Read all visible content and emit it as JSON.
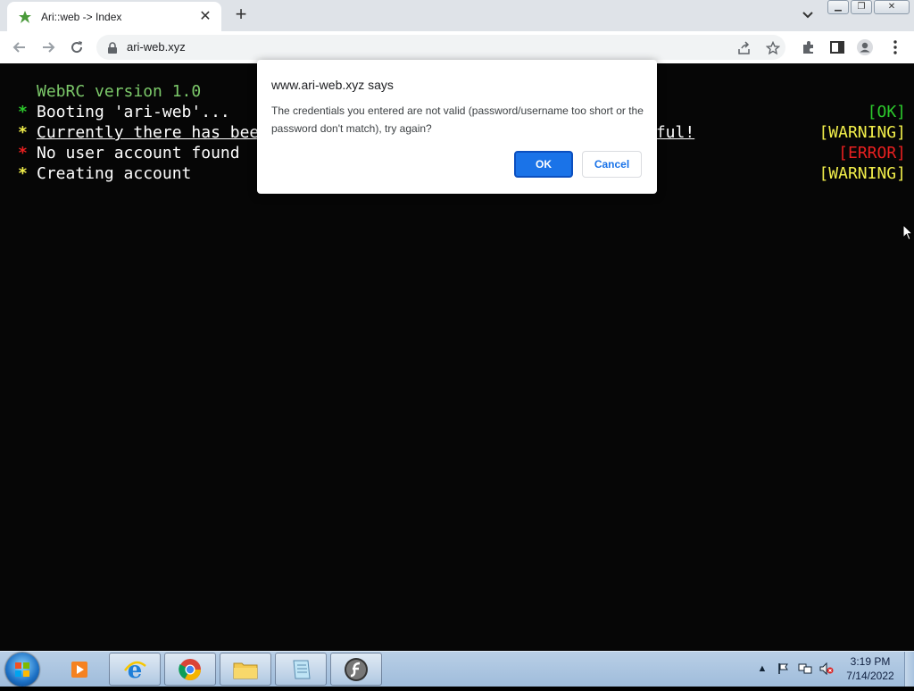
{
  "browser": {
    "tab_title": "Ari::web -> Index",
    "url": "ari-web.xyz",
    "close_tab_glyph": "✕",
    "new_tab_glyph": "+"
  },
  "window_buttons": {
    "minimize": "▁",
    "maximize": "❐",
    "close": "✕"
  },
  "terminal": {
    "title": "WebRC version 1.0",
    "lines": [
      {
        "star": "*",
        "star_color": "#2cc92c",
        "text": "Booting 'ari-web'...",
        "status": "[OK]",
        "status_color": "#2cc92c"
      },
      {
        "star": "*",
        "star_color": "#f2ef4a",
        "text": "Currently there has bee",
        "tail": "eful!",
        "status": "[WARNING]",
        "status_color": "#f2ef4a"
      },
      {
        "star": "*",
        "star_color": "#e82020",
        "text": "No user account found",
        "status": "[ERROR]",
        "status_color": "#e82020"
      },
      {
        "star": "*",
        "star_color": "#f2ef4a",
        "text": "Creating account",
        "status": "[WARNING]",
        "status_color": "#f2ef4a"
      }
    ]
  },
  "dialog": {
    "title": "www.ari-web.xyz says",
    "message": "The credentials you entered are not valid (password/username too short or the password don't match), try again?",
    "ok_label": "OK",
    "cancel_label": "Cancel"
  },
  "taskbar": {
    "time": "3:19 PM",
    "date": "7/14/2022",
    "apps": [
      "media-player-icon",
      "internet-explorer-icon",
      "chrome-icon",
      "file-explorer-icon",
      "notepad-icon",
      "flash-icon"
    ]
  },
  "colors": {
    "accent": "#1a73e8",
    "terminal_bg": "#060606",
    "title_green": "#7cc96a"
  }
}
